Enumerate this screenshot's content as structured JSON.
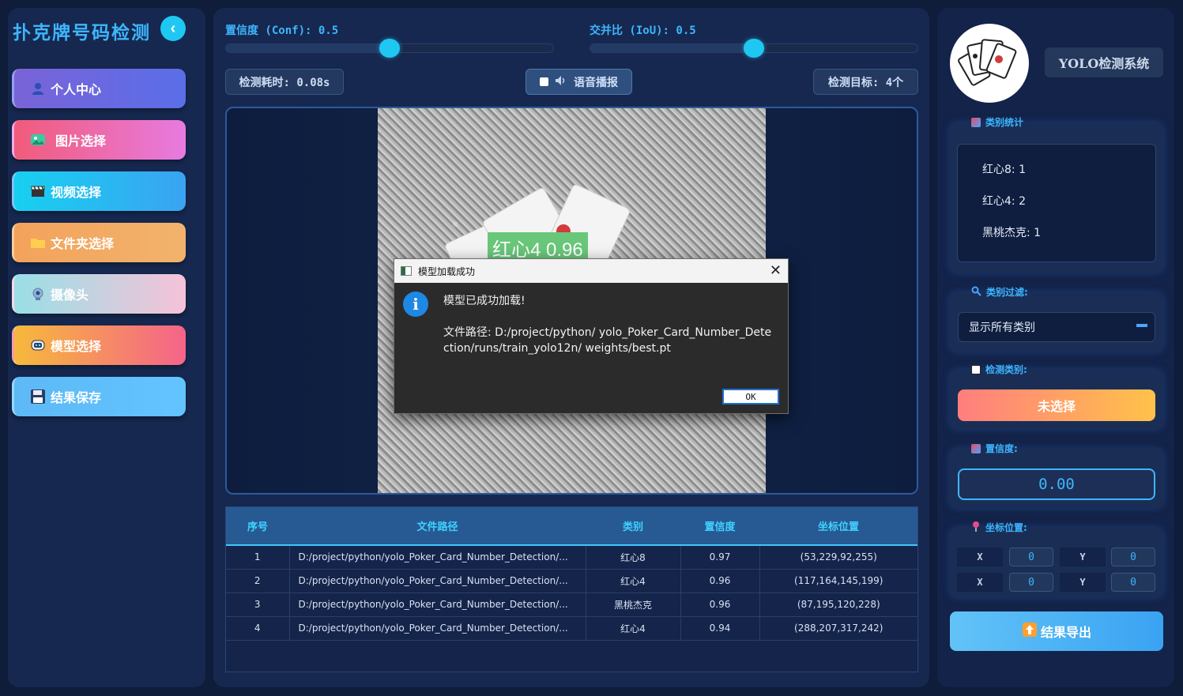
{
  "app": {
    "title": "扑克牌号码检测"
  },
  "nav": [
    {
      "label": "个人中心",
      "icon": "user-icon"
    },
    {
      "label": "图片选择",
      "icon": "image-icon"
    },
    {
      "label": "视频选择",
      "icon": "clapper-icon"
    },
    {
      "label": "文件夹选择",
      "icon": "folder-icon"
    },
    {
      "label": "摄像头",
      "icon": "webcam-icon"
    },
    {
      "label": "模型选择",
      "icon": "robot-icon"
    },
    {
      "label": "结果保存",
      "icon": "floppy-icon"
    }
  ],
  "controls": {
    "conf_label": "置信度 (Conf): 0.5",
    "iou_label": "交并比 (IoU): 0.5",
    "conf_value": 0.5,
    "iou_value": 0.5,
    "time_label": "检测耗时: 0.08s",
    "voice_label": "语音播报",
    "targets_label": "检测目标: 4个"
  },
  "detection_overlay": {
    "label": "红心4 0.96"
  },
  "dialog": {
    "title": "模型加载成功",
    "message": "模型已成功加载!",
    "path": "文件路径: D:/project/python/ yolo_Poker_Card_Number_Detection/runs/train_yolo12n/ weights/best.pt",
    "ok_label": "OK"
  },
  "table": {
    "headers": [
      "序号",
      "文件路径",
      "类别",
      "置信度",
      "坐标位置"
    ],
    "rows": [
      [
        "1",
        "D:/project/python/yolo_Poker_Card_Number_Detection/...",
        "红心8",
        "0.97",
        "(53,229,92,255)"
      ],
      [
        "2",
        "D:/project/python/yolo_Poker_Card_Number_Detection/...",
        "红心4",
        "0.96",
        "(117,164,145,199)"
      ],
      [
        "3",
        "D:/project/python/yolo_Poker_Card_Number_Detection/...",
        "黑桃杰克",
        "0.96",
        "(87,195,120,228)"
      ],
      [
        "4",
        "D:/project/python/yolo_Poker_Card_Number_Detection/...",
        "红心4",
        "0.94",
        "(288,207,317,242)"
      ]
    ]
  },
  "right": {
    "system_title": "YOLO检测系统",
    "stats_label": "类别统计",
    "stats": [
      "红心8: 1",
      "红心4: 2",
      "黑桃杰克: 1"
    ],
    "filter_label": "类别过滤:",
    "filter_value": "显示所有类别",
    "detect_class_label": "检测类别:",
    "detect_class_value": "未选择",
    "confidence_label": "置信度:",
    "confidence_value": "0.00",
    "coord_label": "坐标位置:",
    "coords": {
      "x1_label": "X",
      "y1_label": "Y",
      "x2_label": "X",
      "y2_label": "Y",
      "x1": "0",
      "y1": "0",
      "x2": "0",
      "y2": "0"
    },
    "export_label": "结果导出"
  }
}
